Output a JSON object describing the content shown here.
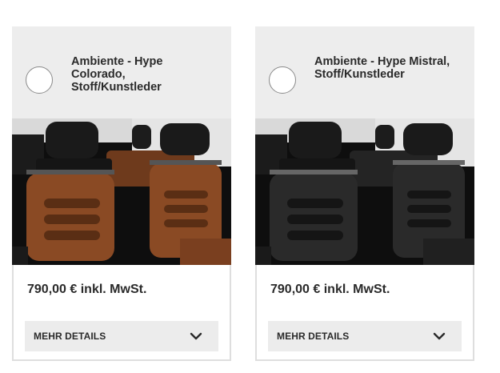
{
  "cards": [
    {
      "title_lines": [
        "Ambiente - Hype",
        "Colorado,",
        "Stoff/Kunstleder"
      ],
      "price": "790,00 € inkl. MwSt.",
      "details_label": "MEHR DETAILS",
      "icons": {
        "radio": "radio-button",
        "chevron": "chevron-down-icon"
      },
      "upholstery_colors": {
        "seat": "#8a4a24",
        "seat_dark": "#5a2e14",
        "back": "#1a1a1a"
      }
    },
    {
      "title_lines": [
        "Ambiente - Hype Mistral,",
        "Stoff/Kunstleder"
      ],
      "price": "790,00 € inkl. MwSt.",
      "details_label": "MEHR DETAILS",
      "icons": {
        "radio": "radio-button",
        "chevron": "chevron-down-icon"
      },
      "upholstery_colors": {
        "seat": "#2a2a2a",
        "seat_dark": "#151515",
        "back": "#1a1a1a"
      }
    }
  ]
}
